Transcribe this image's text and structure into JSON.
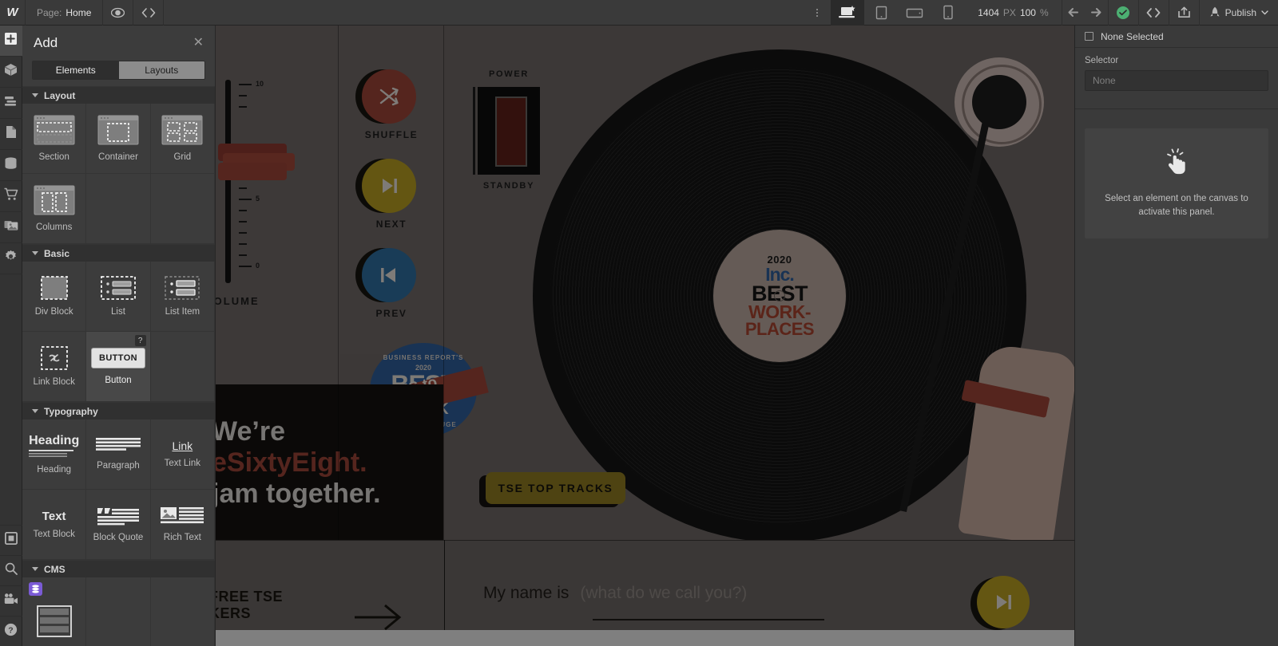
{
  "topbar": {
    "logo": "W",
    "page_label": "Page:",
    "page_value": "Home",
    "preview_icon": "eye-icon",
    "code_icon": "code-brackets-icon",
    "more_icon": "vertical-dots-icon",
    "devices": [
      {
        "name": "desktop",
        "label": "Desktop",
        "active": true
      },
      {
        "name": "tablet",
        "label": "Tablet",
        "active": false
      },
      {
        "name": "mobile-landscape",
        "label": "Mobile Landscape",
        "active": false
      },
      {
        "name": "mobile-portrait",
        "label": "Mobile Portrait",
        "active": false
      }
    ],
    "viewport_width": "1404",
    "viewport_unit": "PX",
    "zoom_value": "100",
    "zoom_unit": "%",
    "undo_icon": "undo-arrow-icon",
    "redo_icon": "redo-arrow-icon",
    "save_status_icon": "green-check-icon",
    "export_code_icon": "code-brackets-icon",
    "share_icon": "share-export-icon",
    "rocket_icon": "rocket-icon",
    "publish_label": "Publish"
  },
  "rail": {
    "items": [
      {
        "name": "add-elements",
        "icon": "plus-icon",
        "active": true
      },
      {
        "name": "components",
        "icon": "box-icon",
        "active": false
      },
      {
        "name": "navigator",
        "icon": "layers-icon",
        "active": false
      },
      {
        "name": "pages",
        "icon": "page-icon",
        "active": false
      },
      {
        "name": "cms",
        "icon": "database-icon",
        "active": false
      },
      {
        "name": "ecommerce",
        "icon": "cart-icon",
        "active": false
      },
      {
        "name": "assets",
        "icon": "images-icon",
        "active": false
      },
      {
        "name": "settings",
        "icon": "gear-icon",
        "active": false
      }
    ],
    "bottom_items": [
      {
        "name": "audit",
        "icon": "square-icon"
      },
      {
        "name": "search",
        "icon": "magnifier-icon"
      },
      {
        "name": "videos",
        "icon": "video-camera-icon"
      },
      {
        "name": "help",
        "icon": "question-mark-icon"
      }
    ]
  },
  "add_panel": {
    "title": "Add",
    "close_icon": "close-icon",
    "tabs": [
      {
        "label": "Elements",
        "active": true
      },
      {
        "label": "Layouts",
        "active": false
      }
    ],
    "sections": [
      {
        "title": "Layout",
        "items": [
          {
            "label": "Section",
            "icon": "section-icon"
          },
          {
            "label": "Container",
            "icon": "container-icon"
          },
          {
            "label": "Grid",
            "icon": "grid-icon"
          },
          {
            "label": "Columns",
            "icon": "columns-icon"
          }
        ]
      },
      {
        "title": "Basic",
        "items": [
          {
            "label": "Div Block",
            "icon": "div-block-icon"
          },
          {
            "label": "List",
            "icon": "list-icon"
          },
          {
            "label": "List Item",
            "icon": "list-item-icon"
          },
          {
            "label": "Link Block",
            "icon": "link-block-icon"
          },
          {
            "label": "Button",
            "icon": "button-icon",
            "glyph": "BUTTON",
            "hovered": true,
            "badge": "?"
          }
        ]
      },
      {
        "title": "Typography",
        "items": [
          {
            "label": "Heading",
            "icon": "heading-icon",
            "glyph": "Heading"
          },
          {
            "label": "Paragraph",
            "icon": "paragraph-icon"
          },
          {
            "label": "Text Link",
            "icon": "text-link-icon",
            "glyph": "Link"
          },
          {
            "label": "Text Block",
            "icon": "text-block-icon",
            "glyph": "Text"
          },
          {
            "label": "Block Quote",
            "icon": "block-quote-icon"
          },
          {
            "label": "Rich Text",
            "icon": "rich-text-icon"
          }
        ]
      },
      {
        "title": "CMS",
        "items": [
          {
            "label": "Collection List",
            "icon": "collection-list-icon",
            "badge_icon": "cms-database-badge"
          }
        ]
      }
    ]
  },
  "right_panel": {
    "tabs": [
      {
        "name": "style",
        "icon": "brush-icon",
        "active": true
      },
      {
        "name": "settings",
        "icon": "gear-icon",
        "active": false
      },
      {
        "name": "interactions",
        "icon": "droplets-icon",
        "active": false
      },
      {
        "name": "effects",
        "icon": "lightning-bolt-icon",
        "active": false
      }
    ],
    "selection_label": "None Selected",
    "selector_label": "Selector",
    "selector_value": "None",
    "empty_icon": "click-hand-icon",
    "empty_text": "Select an element on the canvas to activate this panel."
  },
  "canvas": {
    "volume": {
      "label": "VOLUME",
      "ticks": [
        {
          "value": "10",
          "major": true
        },
        {
          "value": "5",
          "major": true
        },
        {
          "value": "0",
          "major": true
        }
      ]
    },
    "transport": [
      {
        "label": "SHUFFLE",
        "icon": "shuffle-icon",
        "color": "#9c4438"
      },
      {
        "label": "NEXT",
        "icon": "next-track-icon",
        "color": "#b79d22"
      },
      {
        "label": "PREV",
        "icon": "prev-track-icon",
        "color": "#2f6d9e"
      }
    ],
    "power": {
      "top_label": "POWER",
      "bottom_label": "STANDBY"
    },
    "record_label": {
      "year": "2020",
      "brand": "Inc.",
      "line1": "BEST",
      "line2": "WORK-",
      "line3": "PLACES"
    },
    "badge": {
      "line1": "BUSINESS REPORT'S",
      "year": "2020",
      "best": "BEST",
      "ribbon": "PLACES to WORK",
      "location": "IN BATON ROUGE"
    },
    "hero": {
      "line1": "We’re",
      "line2": "eSixtyEight.",
      "line3": "jam together."
    },
    "top_tracks_button": "TSE TOP TRACKS",
    "bottom": {
      "free_line1": "FREE TSE",
      "free_line2": "KERS",
      "arrow_icon": "right-arrow-icon",
      "name_label": "My name is",
      "name_placeholder": "(what do we call you?)",
      "play_icon": "next-track-icon"
    }
  },
  "colors": {
    "accent_red": "#9c4438",
    "accent_yellow": "#b79d22",
    "accent_blue": "#2f6d9e",
    "save_green": "#4caf72",
    "cms_purple": "#7b5bd6"
  }
}
